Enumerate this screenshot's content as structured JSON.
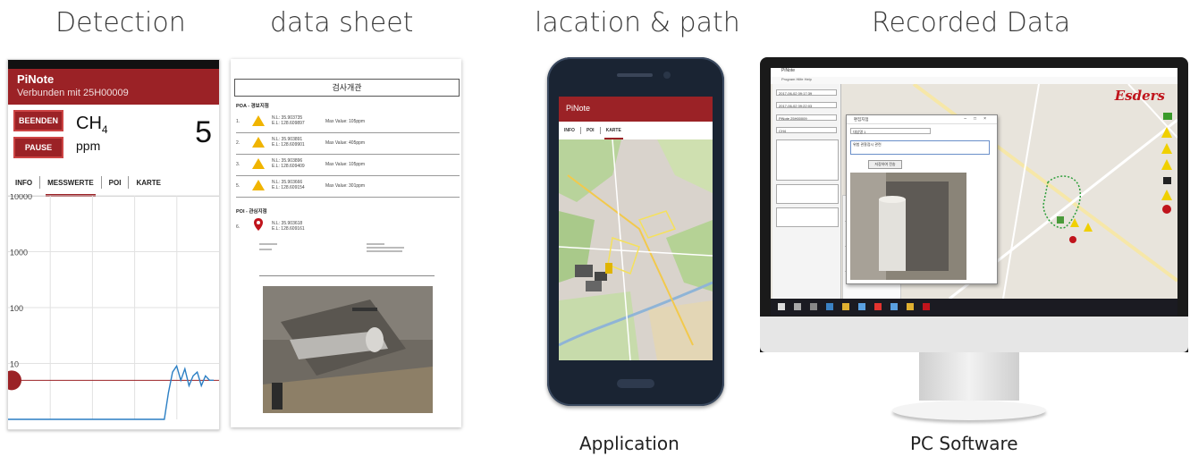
{
  "headings": {
    "detection": "Detection",
    "data_sheet": "data sheet",
    "location": "lacation & path",
    "recorded": "Recorded Data"
  },
  "captions": {
    "application": "Application",
    "pc_software": "PC Software"
  },
  "detection_app": {
    "title": "PiNote",
    "subtitle": "Verbunden mit 25H00009",
    "stop_button": "BEENDEN",
    "pause_button": "PAUSE",
    "gas": "CH",
    "gas_sub": "4",
    "unit": "ppm",
    "value": "5",
    "tabs": [
      "INFO",
      "MESSWERTE",
      "POI",
      "KARTE"
    ],
    "active_tab": "MESSWERTE",
    "accent": "#9b2226",
    "chart_data": {
      "type": "line",
      "title": "",
      "xlabel": "",
      "ylabel": "",
      "y_scale": "log",
      "ylim": [
        1,
        10000
      ],
      "y_ticks": [
        "10000",
        "1000",
        "100",
        "10"
      ],
      "x": [
        0,
        10,
        20,
        30,
        40,
        50,
        60,
        70,
        76,
        78,
        80,
        82,
        84,
        86,
        88,
        90,
        92,
        94,
        96,
        98,
        100
      ],
      "series": [
        {
          "values": [
            1,
            1,
            1,
            1,
            1,
            1,
            1,
            1,
            1,
            3,
            7,
            9,
            5,
            8,
            4,
            6,
            7,
            4,
            6,
            5,
            5
          ]
        }
      ],
      "threshold": 5,
      "grid": true
    }
  },
  "data_sheet": {
    "title": "검사개관",
    "poa_heading": "POA - 경보지점",
    "poi_heading": "POI - 관심지점",
    "rows": [
      {
        "num": "1.",
        "lat": "N.L: 35.903735",
        "lon": "E.L: 128.609897",
        "max": "Max Value: 105ppm"
      },
      {
        "num": "2.",
        "lat": "N.L: 35.903891",
        "lon": "E.L: 128.609901",
        "max": "Max Value: 405ppm"
      },
      {
        "num": "3.",
        "lat": "N.L: 35.903896",
        "lon": "E.L: 128.609409",
        "max": "Max Value: 105ppm"
      },
      {
        "num": "5.",
        "lat": "N.L: 35.903666",
        "lon": "E.L: 128.609154",
        "max": "Max Value: 301ppm"
      }
    ],
    "poi_row": {
      "num": "6.",
      "lat": "N.L: 35.903618",
      "lon": "E.L: 128.609161"
    }
  },
  "phone_app": {
    "title": "PiNote",
    "tabs": [
      "INFO",
      "POI",
      "KARTE"
    ],
    "active_tab": "KARTE"
  },
  "pc_app": {
    "logo": "Esders",
    "window_title": "PiNote",
    "menu": "Program  Hilfe  Help",
    "dialog_title": "편집지점",
    "dialog_field_1": "대상명 1",
    "dialog_field_2": "위험 관찰점시 관련",
    "dialog_button": "저장하여 전송",
    "fields": [
      "2017-06-02 09:17:39",
      "2017-06-02 09:22:03",
      "PiNote 25H00009",
      "CH4"
    ],
    "buttons": [
      "조절하여 필기",
      "표준치",
      "삭제"
    ]
  }
}
